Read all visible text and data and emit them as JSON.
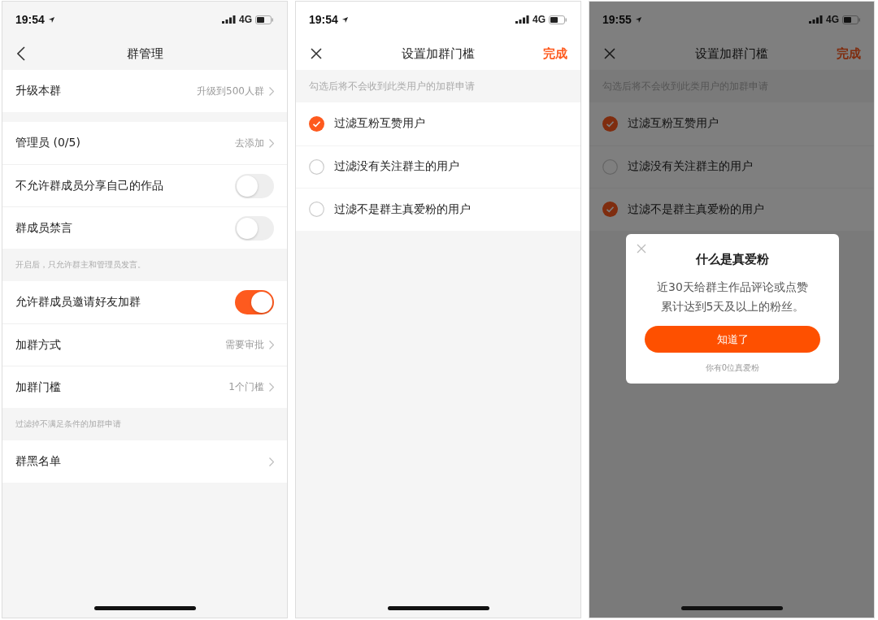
{
  "screens": [
    {
      "kind": "settings",
      "status": {
        "time": "19:54",
        "network": "4G"
      },
      "nav": {
        "left_button": {
          "kind": "back"
        },
        "title": "群管理"
      },
      "sections": [
        {
          "rows": [
            {
              "kind": "link",
              "label": "升级本群",
              "value": "升级到500人群"
            }
          ]
        },
        {
          "rows": [
            {
              "kind": "link",
              "label": "管理员 (0/5)",
              "value": "去添加"
            },
            {
              "kind": "toggle",
              "label": "不允许群成员分享自己的作品",
              "on": false
            },
            {
              "kind": "toggle",
              "label": "群成员禁言",
              "on": false
            }
          ],
          "note": "开启后，只允许群主和管理员发言。"
        },
        {
          "rows": [
            {
              "kind": "toggle",
              "label": "允许群成员邀请好友加群",
              "on": true
            },
            {
              "kind": "link",
              "label": "加群方式",
              "value": "需要审批"
            },
            {
              "kind": "link",
              "label": "加群门槛",
              "value": "1个门槛"
            }
          ],
          "note": "过滤掉不满足条件的加群申请"
        },
        {
          "rows": [
            {
              "kind": "link",
              "label": "群黑名单"
            }
          ]
        }
      ]
    },
    {
      "kind": "filter",
      "status": {
        "time": "19:54",
        "network": "4G"
      },
      "nav": {
        "left_button": {
          "kind": "close"
        },
        "title": "设置加群门槛",
        "action": "完成"
      },
      "hint": "勾选后将不会收到此类用户的加群申请",
      "options": [
        {
          "label": "过滤互粉互赞用户",
          "checked": true
        },
        {
          "label": "过滤没有关注群主的用户",
          "checked": false
        },
        {
          "label": "过滤不是群主真爱粉的用户",
          "checked": false
        }
      ]
    },
    {
      "kind": "filter",
      "status": {
        "time": "19:55",
        "network": "4G"
      },
      "nav": {
        "left_button": {
          "kind": "close"
        },
        "title": "设置加群门槛",
        "action": "完成"
      },
      "hint": "勾选后将不会收到此类用户的加群申请",
      "options": [
        {
          "label": "过滤互粉互赞用户",
          "checked": true
        },
        {
          "label": "过滤没有关注群主的用户",
          "checked": false
        },
        {
          "label": "过滤不是群主真爱粉的用户",
          "checked": true
        }
      ],
      "dialog": {
        "title": "什么是真爱粉",
        "body": "近30天给群主作品评论或点赞累计达到5天及以上的粉丝。",
        "button": "知道了",
        "footnote": "你有0位真爱粉"
      }
    }
  ]
}
